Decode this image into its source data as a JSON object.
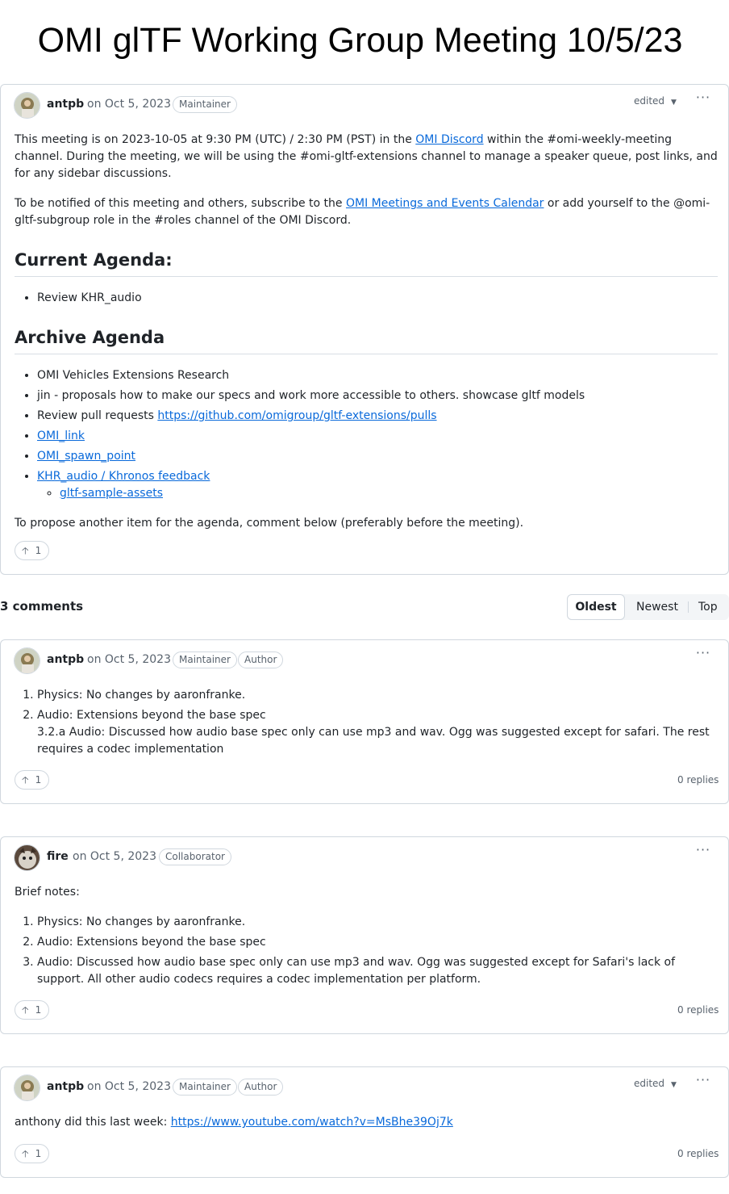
{
  "page_title": "OMI glTF Working Group Meeting 10/5/23",
  "main_post": {
    "author": "antpb",
    "date": "on Oct 5, 2023",
    "badge": "Maintainer",
    "edited": "edited",
    "para1_a": "This meeting is on 2023-10-05 at 9:30 PM (UTC) / 2:30 PM (PST) in the ",
    "para1_link": "OMI Discord",
    "para1_b": " within the #omi-weekly-meeting channel. During the meeting, we will be using the #omi-gltf-extensions channel to manage a speaker queue, post links, and for any sidebar discussions.",
    "para2_a": "To be notified of this meeting and others, subscribe to the ",
    "para2_link": "OMI Meetings and Events Calendar",
    "para2_b": " or add yourself to the @omi-gltf-subgroup role in the #roles channel of the OMI Discord.",
    "heading_current": "Current Agenda:",
    "current_items": [
      "Review KHR_audio"
    ],
    "heading_archive": "Archive Agenda",
    "archive_item1": "OMI Vehicles Extensions Research",
    "archive_item2": "jin - proposals how to make our specs and work more accessible to others. showcase gltf models",
    "archive_item3_text": "Review pull requests ",
    "archive_item3_link": "https://github.com/omigroup/gltf-extensions/pulls",
    "archive_item4_link": "OMI_link",
    "archive_item5_link": "OMI_spawn_point",
    "archive_item6_link": "KHR_audio / Khronos feedback",
    "archive_subitem_link": "gltf-sample-assets",
    "closing": "To propose another item for the agenda, comment below (preferably before the meeting).",
    "upvotes": "1"
  },
  "comments_header": {
    "count_label": "3 comments",
    "sort_options": [
      "Oldest",
      "Newest",
      "Top"
    ],
    "sort_selected": "Oldest"
  },
  "comments": [
    {
      "author": "antpb",
      "date": "on Oct 5, 2023",
      "badges": [
        "Maintainer",
        "Author"
      ],
      "items": [
        "Physics: No changes by aaronfranke.",
        "Audio: Extensions beyond the base spec",
        "3.2.a Audio: Discussed how audio base spec only can use mp3 and wav. Ogg was suggested except for safari. The rest requires a codec implementation"
      ],
      "upvotes": "1",
      "replies": "0 replies"
    },
    {
      "author": "fire",
      "date": "on Oct 5, 2023",
      "badges": [
        "Collaborator"
      ],
      "intro": "Brief notes:",
      "items": [
        "Physics: No changes by aaronfranke.",
        "Audio: Extensions beyond the base spec",
        "Audio: Discussed how audio base spec only can use mp3 and wav. Ogg was suggested except for Safari's lack of support. All other audio codecs requires a codec implementation per platform."
      ],
      "upvotes": "1",
      "replies": "0 replies"
    },
    {
      "author": "antpb",
      "date": "on Oct 5, 2023",
      "badges": [
        "Maintainer",
        "Author"
      ],
      "edited": "edited",
      "text": "anthony did this last week: ",
      "link": "https://www.youtube.com/watch?v=MsBhe39Oj7k",
      "upvotes": "1",
      "replies": "0 replies"
    }
  ],
  "icons": {
    "upvote": "arrow-up-icon",
    "more": "kebab-horizontal-icon",
    "caret": "triangle-down-icon"
  }
}
